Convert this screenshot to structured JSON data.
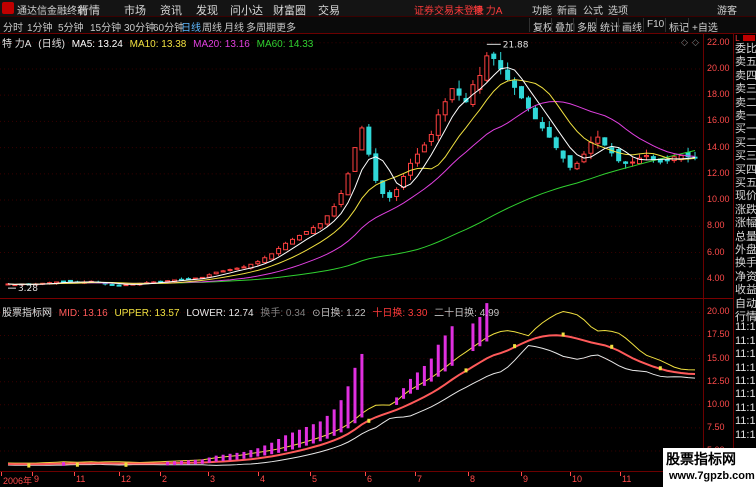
{
  "menubar": {
    "app_title": "通达信金融终端",
    "menus": [
      "行情",
      "市场",
      "资讯",
      "发现",
      "问小达",
      "财富圈",
      "交易"
    ],
    "login_notice": "证券交易未登录",
    "stock_name": "特 力A",
    "right_menus": [
      "功能",
      "新画",
      "公式",
      "选项",
      "游客"
    ]
  },
  "toolbar": {
    "periods": [
      "分时",
      "1分钟",
      "5分钟",
      "15分钟",
      "30分钟",
      "60分钟",
      "日线",
      "周线",
      "月线",
      "多周期",
      "更多"
    ],
    "active_period": "日线",
    "buttons": [
      "复权",
      "叠加",
      "多股",
      "统计",
      "画线",
      "F10",
      "标记",
      "+自选"
    ]
  },
  "main_chart": {
    "title": "特 力A",
    "period_label": "(日线)",
    "ma": [
      {
        "label": "MA5: 13.24",
        "color": "#ffffff"
      },
      {
        "label": "MA10: 13.38",
        "color": "#f0e040"
      },
      {
        "label": "MA20: 13.16",
        "color": "#e040e0"
      },
      {
        "label": "MA60: 14.33",
        "color": "#30d030"
      }
    ],
    "y_ticks": [
      "22.00",
      "20.00",
      "18.00",
      "16.00",
      "14.00",
      "12.00",
      "10.00",
      "8.00",
      "6.00",
      "4.00"
    ],
    "high_label": "21.88",
    "low_label": "3.28"
  },
  "sub_chart": {
    "name": "股票指标网",
    "fields": [
      {
        "label": "MID: 13.16",
        "color": "#ff5a5a"
      },
      {
        "label": "UPPER: 13.57",
        "color": "#f0e040"
      },
      {
        "label": "LOWER: 12.74",
        "color": "#e8e8e8"
      },
      {
        "label": "换手: 0.34",
        "color": "#808080"
      },
      {
        "label": "⊙日换: 1.22",
        "color": "#c0c0c0"
      },
      {
        "label": "十日换: 3.30",
        "color": "#ff3b3b"
      },
      {
        "label": "二十日换: 4.99",
        "color": "#c0c0c0"
      }
    ],
    "y_ticks": [
      "20.00",
      "17.50",
      "15.00",
      "12.50",
      "10.00",
      "7.50",
      "5.00"
    ]
  },
  "date_axis": {
    "labels": [
      "2006年",
      "9",
      "11",
      "12",
      "2",
      "3",
      "4",
      "5",
      "6",
      "7",
      "8",
      "9",
      "10",
      "11"
    ]
  },
  "side_panel": {
    "labels": [
      "委比",
      "卖五",
      "卖四",
      "卖三",
      "卖二",
      "卖一",
      "买一",
      "买二",
      "买三",
      "买四",
      "买五",
      "现价",
      "涨跌",
      "涨幅",
      "总量",
      "外盘",
      "换手",
      "净资",
      "收益",
      "自动",
      "行情",
      "11:1",
      "11:1",
      "11:1",
      "11:1",
      "11:1",
      "11:1",
      "11:1",
      "11:1",
      "11:1"
    ]
  },
  "watermark": {
    "title": "股票指标网",
    "url": "www.7gpzb.com"
  },
  "chart_data": {
    "type": "candlestick",
    "title": "特 力A (日线)",
    "ylim": [
      3,
      22.5
    ],
    "annotations": {
      "high": 21.88,
      "low": 3.28
    },
    "close": [
      3.6,
      3.55,
      3.6,
      3.55,
      3.6,
      3.65,
      3.7,
      3.75,
      3.8,
      3.75,
      3.7,
      3.75,
      3.8,
      3.7,
      3.6,
      3.55,
      3.5,
      3.55,
      3.6,
      3.65,
      3.7,
      3.75,
      3.8,
      3.85,
      3.9,
      3.95,
      4.0,
      4.05,
      4.1,
      4.3,
      4.5,
      4.6,
      4.7,
      4.8,
      4.9,
      5.1,
      5.3,
      5.6,
      5.9,
      6.3,
      6.7,
      7.0,
      7.3,
      7.6,
      7.9,
      8.2,
      8.8,
      9.5,
      10.5,
      12.0,
      14.0,
      15.5,
      13.5,
      11.5,
      10.5,
      10.2,
      10.8,
      11.8,
      12.8,
      13.5,
      14.2,
      15.0,
      16.5,
      17.5,
      18.5,
      18.0,
      17.5,
      18.8,
      19.5,
      21.0,
      20.8,
      20.0,
      19.2,
      18.6,
      17.8,
      17.0,
      16.2,
      15.5,
      14.8,
      14.0,
      13.2,
      12.5,
      12.8,
      13.5,
      14.4,
      14.8,
      14.2,
      13.6,
      13.0,
      12.8,
      12.9,
      13.2,
      13.4,
      13.1,
      12.9,
      13.0,
      13.3,
      13.4,
      13.3,
      13.24
    ],
    "ma5_last": 13.24,
    "ma10_last": 13.38,
    "ma20_last": 13.16,
    "ma60_last": 14.33
  }
}
